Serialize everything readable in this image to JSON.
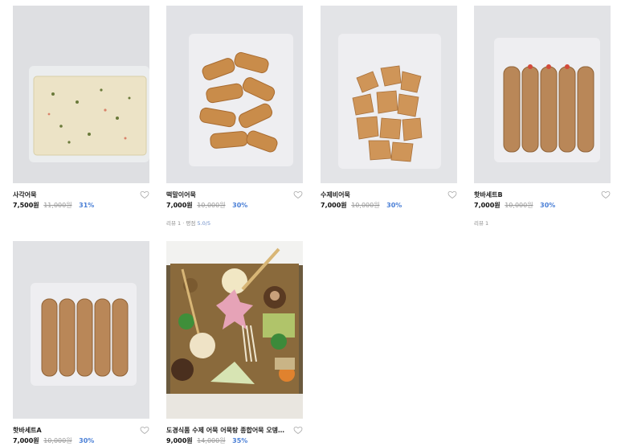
{
  "products": [
    {
      "name": "사각어묵",
      "price": "7,500원",
      "original_price": "11,000원",
      "discount": "31%",
      "review": "",
      "rating_label": "",
      "rating": ""
    },
    {
      "name": "떡말이어묵",
      "price": "7,000원",
      "original_price": "10,000원",
      "discount": "30%",
      "review": "리뷰 1",
      "rating_label": "평점",
      "rating": "5.0/5"
    },
    {
      "name": "수제비어묵",
      "price": "7,000원",
      "original_price": "10,000원",
      "discount": "30%",
      "review": "",
      "rating_label": "",
      "rating": ""
    },
    {
      "name": "핫바세트B",
      "price": "7,000원",
      "original_price": "10,000원",
      "discount": "30%",
      "review": "리뷰 1",
      "rating_label": "",
      "rating": ""
    },
    {
      "name": "핫바세트A",
      "price": "7,000원",
      "original_price": "10,000원",
      "discount": "30%",
      "review": "",
      "rating_label": "",
      "rating": ""
    },
    {
      "name": "도경식품 수제 어묵 어묵탕 종합어묵 오뎅탕 ...",
      "price": "9,000원",
      "original_price": "14,000원",
      "discount": "35%",
      "review": "",
      "rating_label": "",
      "rating": ""
    }
  ],
  "icons": {
    "wishlist": "heart-outline-icon"
  },
  "colors": {
    "discount": "#4a7fd6",
    "thumb_bg": "#e6e7ea"
  }
}
